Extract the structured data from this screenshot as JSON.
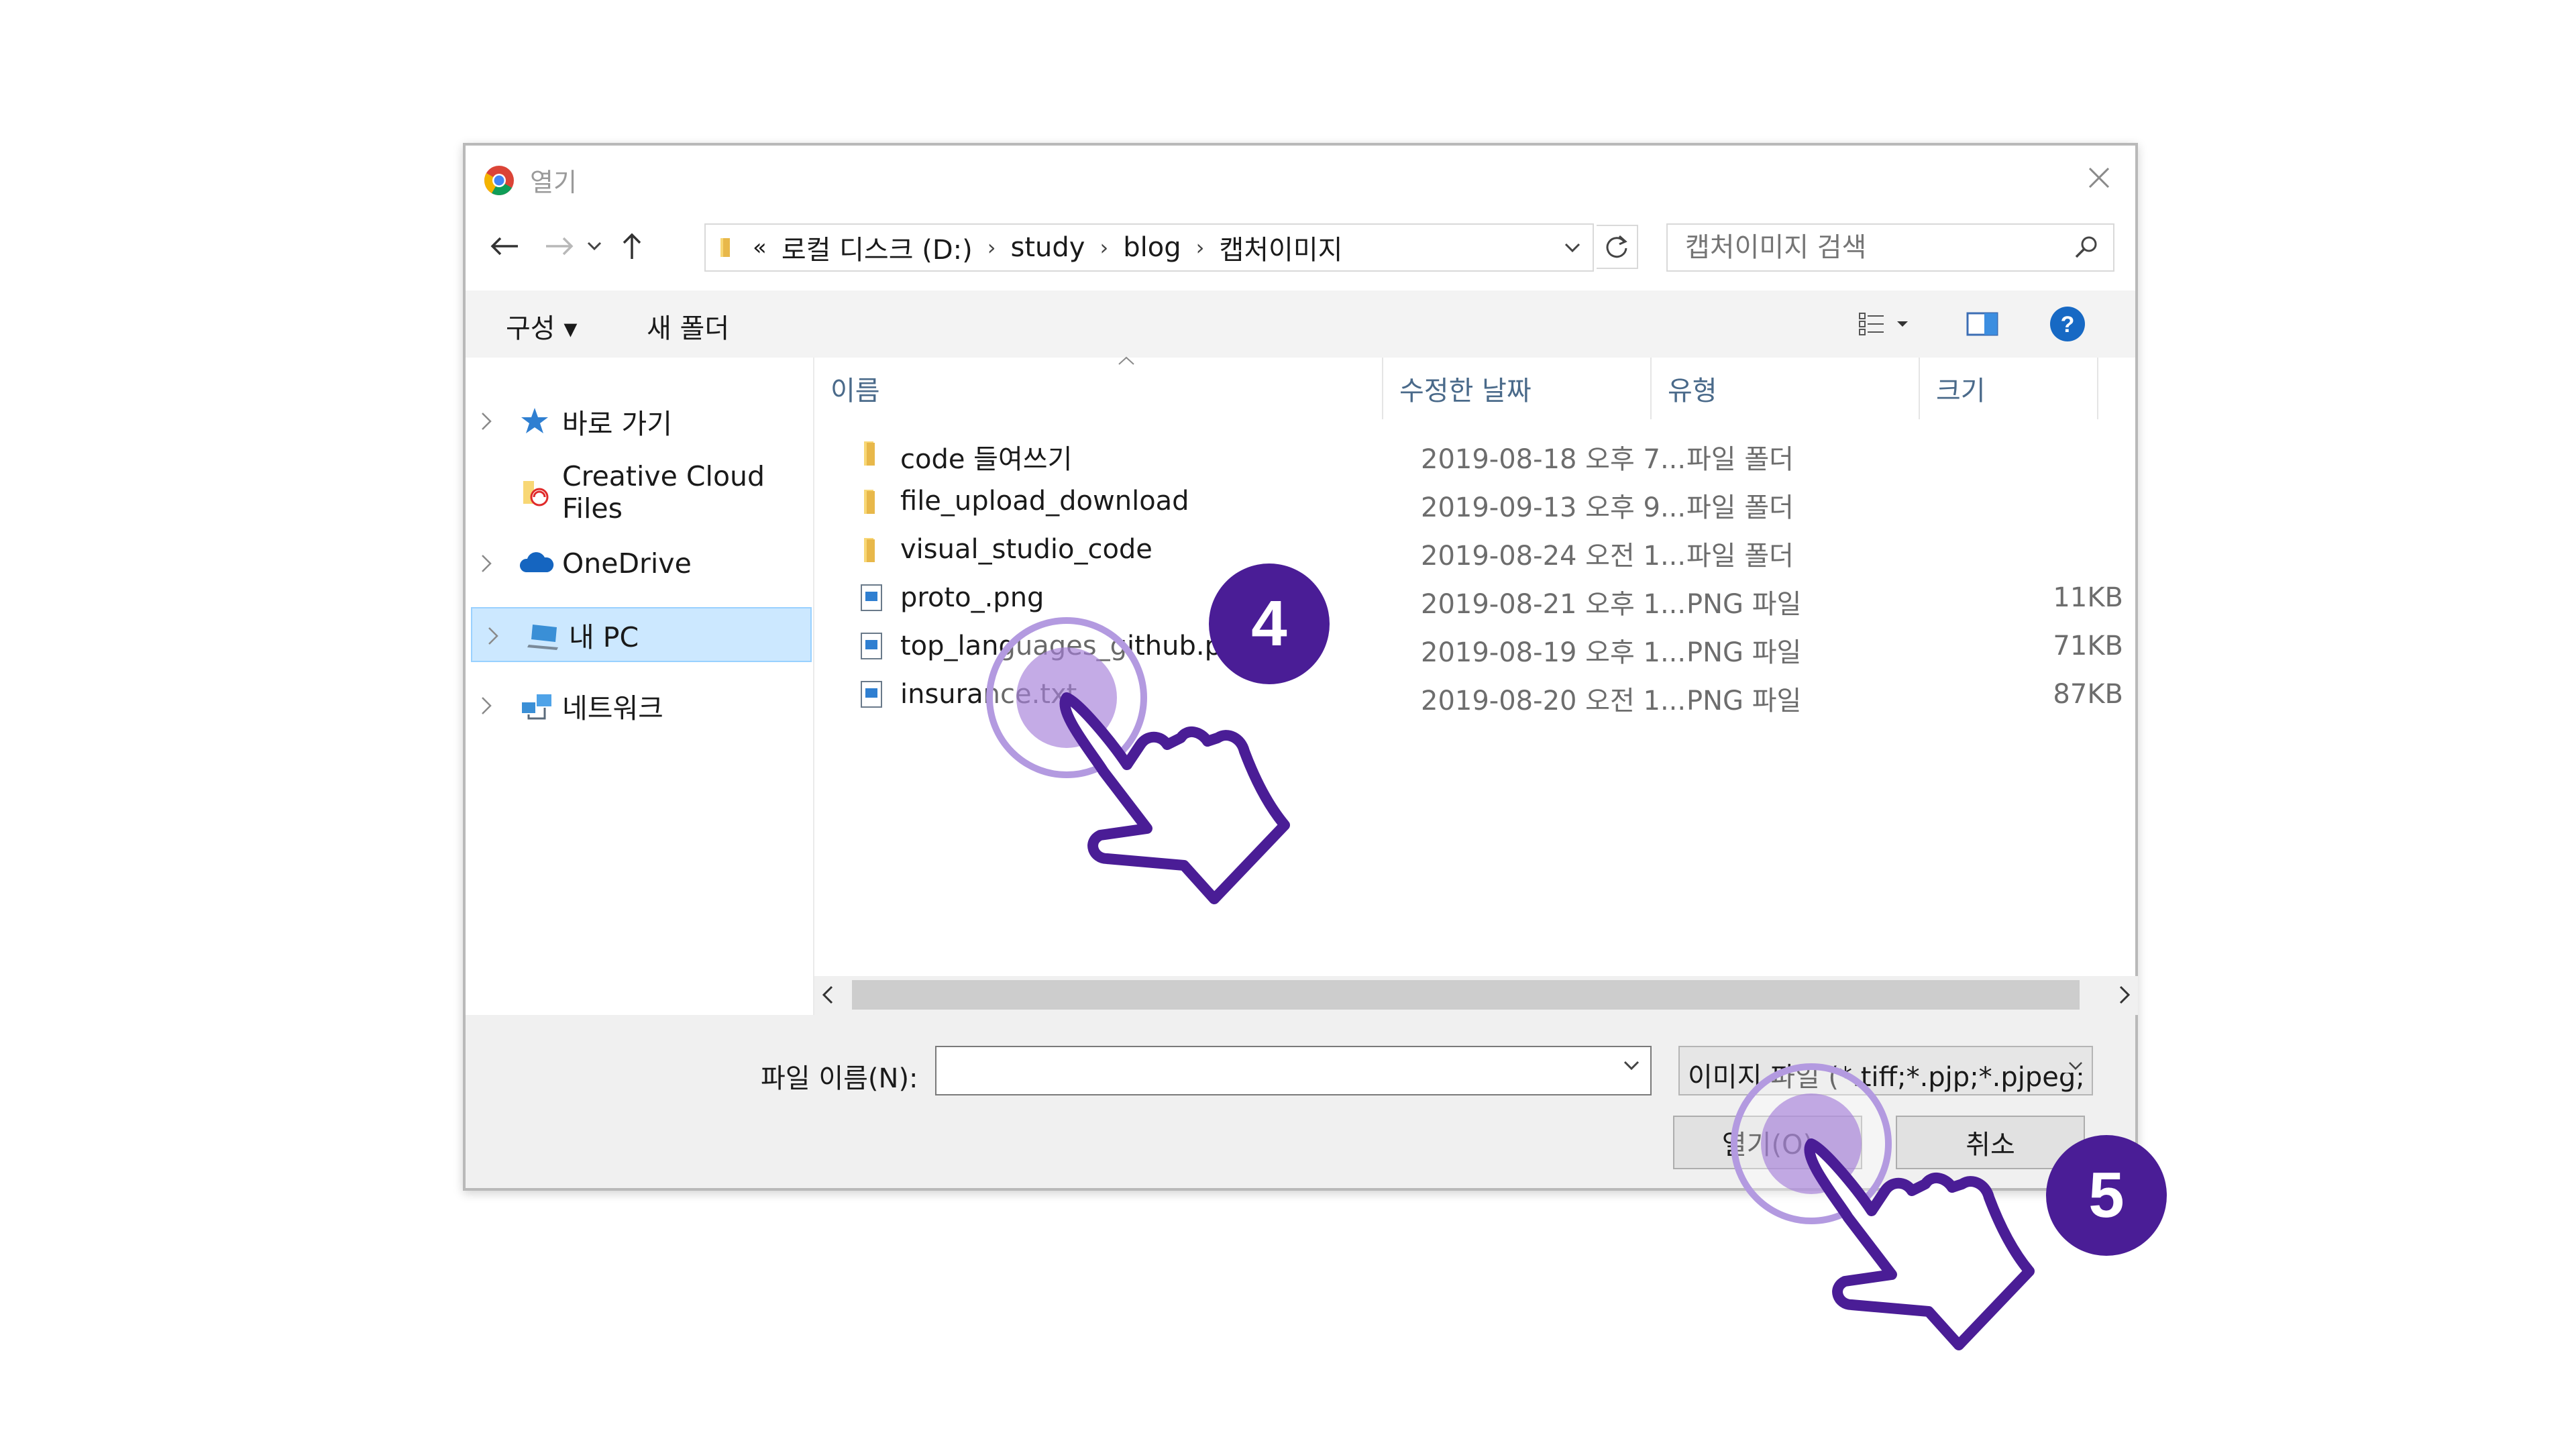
{
  "dialog": {
    "title": "열기",
    "address": {
      "overflow_glyph": "«",
      "crumbs": [
        "로컬 디스크 (D:)",
        "study",
        "blog",
        "캡처이미지"
      ]
    },
    "search": {
      "placeholder": "캡처이미지 검색"
    },
    "toolbar": {
      "organize_label": "구성 ▾",
      "new_folder_label": "새 폴더"
    },
    "sidebar": {
      "items": [
        {
          "label": "바로 가기",
          "icon": "star-icon"
        },
        {
          "label": "Creative Cloud Files",
          "icon": "creative-cloud-icon"
        },
        {
          "label": "OneDrive",
          "icon": "onedrive-cloud-icon"
        },
        {
          "label": "내 PC",
          "icon": "pc-icon",
          "selected": true
        },
        {
          "label": "네트워크",
          "icon": "network-icon"
        }
      ]
    },
    "columns": {
      "name": "이름",
      "date": "수정한 날짜",
      "type": "유형",
      "size": "크기"
    },
    "files": [
      {
        "name": "code 들여쓰기",
        "date": "2019-08-18 오후 7...",
        "type": "파일 폴더",
        "size": "",
        "kind": "folder"
      },
      {
        "name": "file_upload_download",
        "date": "2019-09-13 오후 9...",
        "type": "파일 폴더",
        "size": "",
        "kind": "folder"
      },
      {
        "name": "visual_studio_code",
        "date": "2019-08-24 오전 1...",
        "type": "파일 폴더",
        "size": "",
        "kind": "folder"
      },
      {
        "name": "proto_.png",
        "date": "2019-08-21 오후 1...",
        "type": "PNG 파일",
        "size": "11KB",
        "kind": "image"
      },
      {
        "name": "top_languages_github.png",
        "date": "2019-08-19 오후 1...",
        "type": "PNG 파일",
        "size": "71KB",
        "kind": "image"
      },
      {
        "name": "insurance.txt",
        "date": "2019-08-20 오전 1...",
        "type": "PNG 파일",
        "size": "87KB",
        "kind": "image"
      }
    ],
    "footer": {
      "filename_label": "파일 이름(N):",
      "filename_value": "",
      "filter_value": "이미지 파일 (*.tiff;*.pjp;*.pjpeg;",
      "open_label": "열기(O)",
      "cancel_label": "취소"
    }
  },
  "annotations": {
    "step4": "4",
    "step5": "5",
    "accent_color": "#4a1d96",
    "highlight_color": "#a57ed9"
  }
}
